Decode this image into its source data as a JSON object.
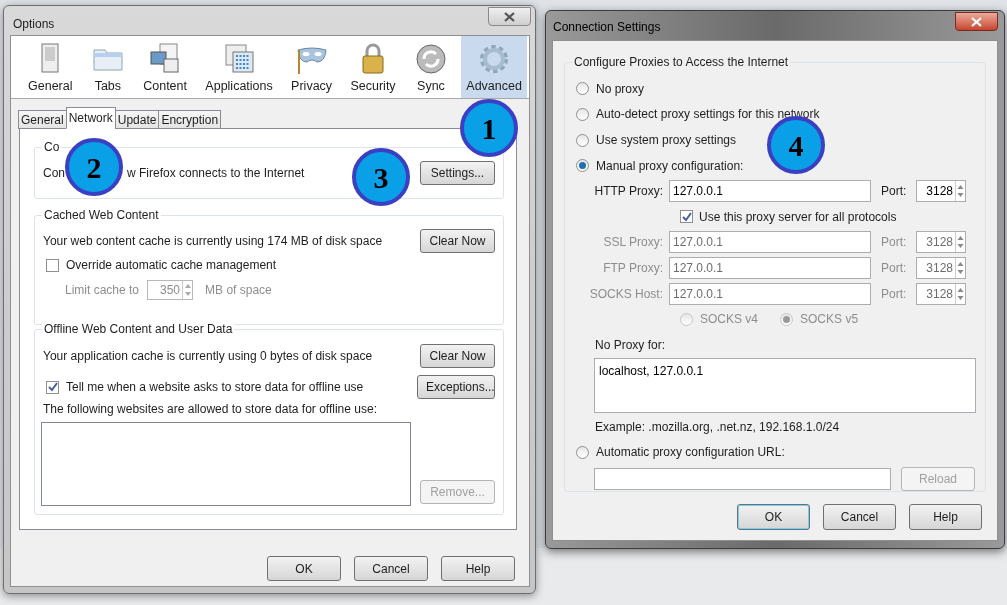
{
  "options_window": {
    "title": "Options",
    "categories": [
      {
        "label": "General",
        "kind": "general",
        "selected": false
      },
      {
        "label": "Tabs",
        "kind": "tabs",
        "selected": false
      },
      {
        "label": "Content",
        "kind": "content",
        "selected": false
      },
      {
        "label": "Applications",
        "kind": "applications",
        "selected": false
      },
      {
        "label": "Privacy",
        "kind": "privacy",
        "selected": false
      },
      {
        "label": "Security",
        "kind": "security",
        "selected": false
      },
      {
        "label": "Sync",
        "kind": "sync",
        "selected": false
      },
      {
        "label": "Advanced",
        "kind": "advanced",
        "selected": true
      }
    ],
    "subtabs": [
      {
        "label": "General",
        "selected": false
      },
      {
        "label": "Network",
        "selected": true
      },
      {
        "label": "Update",
        "selected": false
      },
      {
        "label": "Encryption",
        "selected": false
      }
    ],
    "connection_group": {
      "title": "Co",
      "description_start": "Con",
      "description_end": "w Firefox connects to the Internet",
      "button": "Settings..."
    },
    "cache_group": {
      "title": "Cached Web Content",
      "usage": "Your web content cache is currently using 174 MB of disk space",
      "button": "Clear Now",
      "override": {
        "label": "Override automatic cache management",
        "checked": false
      },
      "limit": {
        "label": "Limit cache to",
        "value": "350",
        "unit": "MB of space",
        "disabled": true
      }
    },
    "offline_group": {
      "title": "Offline Web Content and User Data",
      "usage": "Your application cache is currently using 0 bytes of disk space",
      "clear_button": "Clear Now",
      "notify": {
        "label": "Tell me when a website asks to store data for offline use",
        "checked": true
      },
      "exceptions_button": "Exceptions...",
      "list_label": "The following websites are allowed to store data for offline use:",
      "remove_button": {
        "label": "Remove...",
        "disabled": true
      }
    },
    "buttons": [
      {
        "label": "OK"
      },
      {
        "label": "Cancel"
      },
      {
        "label": "Help"
      }
    ]
  },
  "connection_window": {
    "title": "Connection Settings",
    "group_title": "Configure Proxies to Access the Internet",
    "modes": [
      {
        "label": "No proxy",
        "selected": false
      },
      {
        "label": "Auto-detect proxy settings for this network",
        "selected": false
      },
      {
        "label": "Use system proxy settings",
        "selected": false
      },
      {
        "label": "Manual proxy configuration:",
        "selected": true
      }
    ],
    "proxies": [
      {
        "label": "HTTP Proxy:",
        "value": "127.0.0.1",
        "port_label": "Port:",
        "port": "3128",
        "disabled": false
      },
      {
        "label": "SSL Proxy:",
        "value": "127.0.0.1",
        "port_label": "Port:",
        "port": "3128",
        "disabled": true
      },
      {
        "label": "FTP Proxy:",
        "value": "127.0.0.1",
        "port_label": "Port:",
        "port": "3128",
        "disabled": true
      },
      {
        "label": "SOCKS Host:",
        "value": "127.0.0.1",
        "port_label": "Port:",
        "port": "3128",
        "disabled": true
      }
    ],
    "share_all": {
      "label": "Use this proxy server for all protocols",
      "checked": true
    },
    "socks_versions": [
      {
        "label": "SOCKS v4",
        "selected": false,
        "disabled": true
      },
      {
        "label": "SOCKS v5",
        "selected": true,
        "disabled": true
      }
    ],
    "no_proxy_label": "No Proxy for:",
    "no_proxy_value": "localhost, 127.0.0.1",
    "example": "Example: .mozilla.org, .net.nz, 192.168.1.0/24",
    "auto_url": {
      "label": "Automatic proxy configuration URL:",
      "selected": false
    },
    "reload_button": {
      "label": "Reload",
      "disabled": true
    },
    "buttons": [
      {
        "label": "OK",
        "default": true
      },
      {
        "label": "Cancel",
        "default": false
      },
      {
        "label": "Help",
        "default": false
      }
    ]
  },
  "annotations": [
    {
      "number": "1"
    },
    {
      "number": "2"
    },
    {
      "number": "3"
    },
    {
      "number": "4"
    }
  ]
}
